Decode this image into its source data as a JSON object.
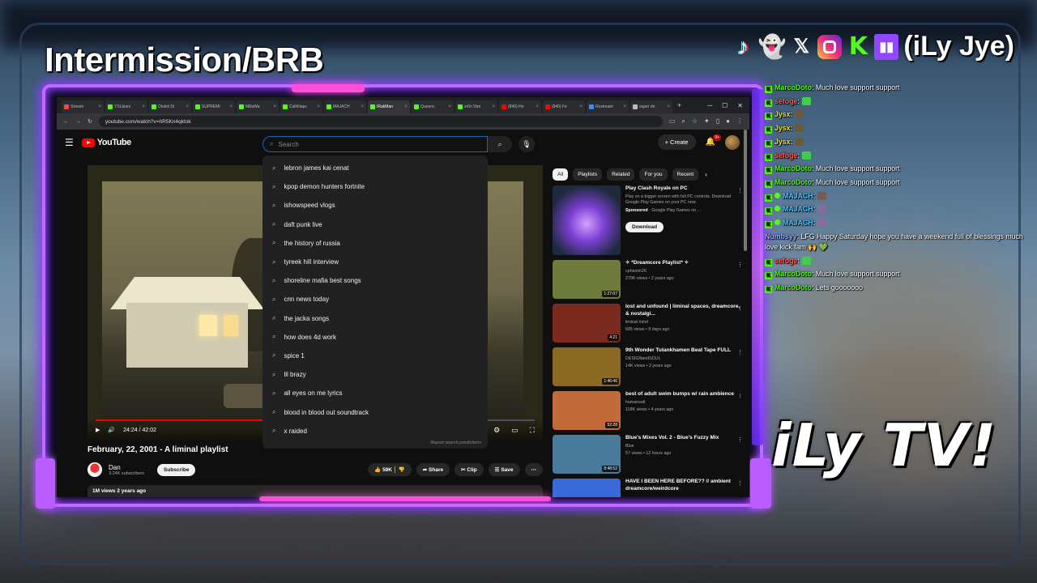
{
  "overlay": {
    "title": "Intermission/BRB",
    "handle": "(iLy Jye)",
    "brand": "iLy TV!",
    "socials": [
      "tiktok-icon",
      "snapchat-icon",
      "x-icon",
      "instagram-icon",
      "kick-icon",
      "twitch-icon"
    ],
    "x_glyph": "𝕏",
    "kick_glyph": "K",
    "twitch_glyph": "▮▮"
  },
  "browser": {
    "tabs": [
      {
        "label": "Stream",
        "color": "#ff4040"
      },
      {
        "label": "YSLbiani",
        "color": "#53fc18"
      },
      {
        "label": "Olubiii St",
        "color": "#53fc18"
      },
      {
        "label": "SUPREMI",
        "color": "#53fc18"
      },
      {
        "label": "MillaWa",
        "color": "#53fc18"
      },
      {
        "label": "CalhNapc",
        "color": "#53fc18"
      },
      {
        "label": "MAJACH",
        "color": "#53fc18"
      },
      {
        "label": "IRakMan",
        "color": "#53fc18"
      },
      {
        "label": "Queenc",
        "color": "#53fc18"
      },
      {
        "label": "xr0n Stre",
        "color": "#53fc18"
      },
      {
        "label": "(840) Ho",
        "color": "#ff0000"
      },
      {
        "label": "(840) Fe",
        "color": "#ff0000"
      },
      {
        "label": "Restream",
        "color": "#3a8bff"
      },
      {
        "label": "super do",
        "color": "#bbbbbb"
      }
    ],
    "new_tab": "+",
    "url": "youtube.com/watch?v=hR5Kn4qktok"
  },
  "youtube": {
    "logo": "YouTube",
    "search_placeholder": "Search",
    "create_label": "Create",
    "notif_badge": "9+",
    "suggestions": [
      "lebron james kai cenat",
      "kpop demon hunters fortnite",
      "ishowspeed vlogs",
      "daft punk live",
      "the history of russia",
      "tyreek hill interview",
      "shoreline mafia best songs",
      "cnn news today",
      "the jacka songs",
      "how does 4d work",
      "spice 1",
      "lil brazy",
      "all eyes on me lyrics",
      "blood in blood out soundtrack",
      "x raided"
    ],
    "report_label": "Report search predictions",
    "player": {
      "time": "24:24 / 42:02",
      "progress": 0.58
    },
    "video": {
      "title": "February, 22, 2001 - A liminal playlist",
      "channel": "Dan",
      "subs": "3.24K subscribers",
      "subscribe": "Subscribe",
      "likes": "59K",
      "share": "Share",
      "clip": "Clip",
      "save": "Save",
      "meta": "1M views  2 years ago"
    },
    "chips": [
      "All",
      "Playlists",
      "Related",
      "For you",
      "Recent"
    ],
    "ad": {
      "title": "Play Clash Royale on PC",
      "body": "Play on a bigger screen with full PC controls. Download Google Play Games on your PC now.",
      "sponsored": "Sponsored",
      "advertiser": "Google Play Games on ...",
      "cta": "Download"
    },
    "recs": [
      {
        "title": "✧ *Dreamcore Playlist* ✧",
        "channel": "cphanim26",
        "stats": "279K views • 2 years ago",
        "duration": "1:27:07",
        "color": "#6e7a3a"
      },
      {
        "title": "lost and unfound | liminal spaces, dreamcore, & nostalgi...",
        "channel": "liminal mind",
        "stats": "685 views • 8 days ago",
        "duration": "4:21",
        "color": "#7a2a1e"
      },
      {
        "title": "9th Wonder  Tutankhamen Beat Tape FULL",
        "channel": "DESIGNandSOUL",
        "stats": "14K views • 3 years ago",
        "duration": "1:46:46",
        "color": "#8a6a20"
      },
      {
        "title": "best of adult swim bumps w/ rain ambience",
        "channel": "humansalt",
        "stats": "118K views • 4 years ago",
        "duration": "52:28",
        "color": "#c26a3a"
      },
      {
        "title": "Blue's Mixes Vol. 2 - Blue's Fuzzy Mix",
        "channel": "Blue",
        "stats": "57 views • 12 hours ago",
        "duration": "8:48:52",
        "color": "#4a7a9a"
      },
      {
        "title": "HAVE I BEEN HERE BEFORE?? // ambient dreamcore/weirdcore",
        "channel": "",
        "stats": "",
        "duration": "",
        "color": "#3a6ad8"
      }
    ]
  },
  "chat": [
    {
      "user": "MarcoDoto",
      "cls": "u-marco",
      "text": ": Much love support support",
      "badge": "k"
    },
    {
      "user": "sefoge",
      "cls": "u-sefoge",
      "text": ":",
      "badge": "k",
      "emote": "#3ecf4a"
    },
    {
      "user": "Jysx",
      "cls": "u-jysx",
      "text": ":",
      "badge": "k",
      "emote": "#6b5a3a"
    },
    {
      "user": "Jysx",
      "cls": "u-jysx",
      "text": ":",
      "badge": "k",
      "emote": "#6b5a3a"
    },
    {
      "user": "Jysx",
      "cls": "u-jysx",
      "text": ":",
      "badge": "k",
      "emote": "#6b5a3a"
    },
    {
      "user": "sefoge",
      "cls": "u-sefoge",
      "text": ":",
      "badge": "k",
      "emote": "#3ecf4a"
    },
    {
      "user": "MarcoDoto",
      "cls": "u-marco",
      "text": ": Much love support support",
      "badge": "k"
    },
    {
      "user": "MarcoDoto",
      "cls": "u-marco",
      "text": ": Much love support support",
      "badge": "k"
    },
    {
      "user": "MAJACH",
      "cls": "u-majach",
      "text": ":",
      "badge": "ks",
      "emote": "#7a5a4a"
    },
    {
      "user": "MAJACH",
      "cls": "u-majach",
      "text": ":",
      "badge": "ks",
      "emote": "#8a6aa0"
    },
    {
      "user": "MAJACH",
      "cls": "u-majach",
      "text": ":",
      "badge": "ks",
      "emote": "#8a6aa0"
    },
    {
      "user": "Numbsyy",
      "cls": "u-numb",
      "text": ": LFG Happy Saturday hope you have a weekend full of blessings much love kick fam 🙌 💚",
      "badge": "",
      "wrap": true
    },
    {
      "user": "sefoge",
      "cls": "u-sefoge",
      "text": ":",
      "badge": "k",
      "emote": "#3ecf4a"
    },
    {
      "user": "MarcoDoto",
      "cls": "u-marco",
      "text": ": Much love support support",
      "badge": "k"
    },
    {
      "user": "MarcoDoto",
      "cls": "u-marco",
      "text": ": Lets gooooooo",
      "badge": "k"
    }
  ]
}
